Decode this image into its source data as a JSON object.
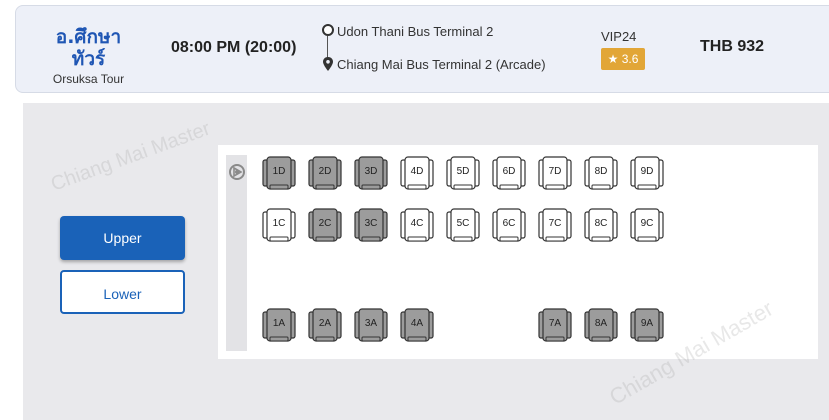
{
  "trip": {
    "operator_logo": "อ.ศึกษาทัวร์",
    "operator_name": "Orsuksa Tour",
    "departure_time": "08:00 PM (20:00)",
    "origin": "Udon Thani Bus Terminal 2",
    "destination": "Chiang Mai Bus Terminal 2 (Arcade)",
    "bus_class": "VIP24",
    "rating": "3.6",
    "price": "THB 932"
  },
  "deck": {
    "upper_label": "Upper",
    "lower_label": "Lower",
    "selected": "Upper"
  },
  "colors": {
    "accent": "#1a62b8",
    "rating_badge": "#e2a637",
    "seat_booked": "#9c9c9c",
    "seat_available": "#ffffff"
  },
  "seats": {
    "row_d": [
      {
        "label": "1D",
        "status": "booked"
      },
      {
        "label": "2D",
        "status": "booked"
      },
      {
        "label": "3D",
        "status": "booked"
      },
      {
        "label": "4D",
        "status": "available"
      },
      {
        "label": "5D",
        "status": "available"
      },
      {
        "label": "6D",
        "status": "available"
      },
      {
        "label": "7D",
        "status": "available"
      },
      {
        "label": "8D",
        "status": "available"
      },
      {
        "label": "9D",
        "status": "available"
      }
    ],
    "row_c": [
      {
        "label": "1C",
        "status": "available"
      },
      {
        "label": "2C",
        "status": "booked"
      },
      {
        "label": "3C",
        "status": "booked"
      },
      {
        "label": "4C",
        "status": "available"
      },
      {
        "label": "5C",
        "status": "available"
      },
      {
        "label": "6C",
        "status": "available"
      },
      {
        "label": "7C",
        "status": "available"
      },
      {
        "label": "8C",
        "status": "available"
      },
      {
        "label": "9C",
        "status": "available"
      }
    ],
    "row_a": [
      {
        "label": "1A",
        "status": "booked"
      },
      {
        "label": "2A",
        "status": "booked"
      },
      {
        "label": "3A",
        "status": "booked"
      },
      {
        "label": "4A",
        "status": "booked"
      },
      {
        "label": "7A",
        "status": "booked"
      },
      {
        "label": "8A",
        "status": "booked"
      },
      {
        "label": "9A",
        "status": "booked"
      }
    ]
  },
  "watermark": "Chiang Mai Master"
}
